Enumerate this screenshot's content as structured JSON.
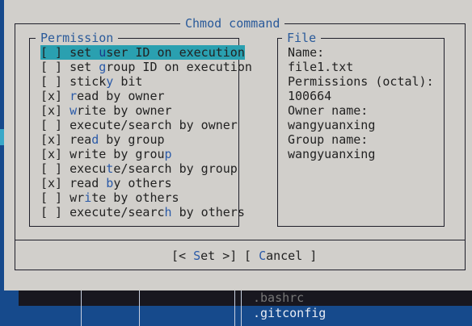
{
  "dialog": {
    "title": "Chmod command",
    "permission_legend": "Permission",
    "file_legend": "File",
    "permissions": [
      {
        "label": "set user ID on execution",
        "checked": false,
        "hotkey": 4,
        "selected": true
      },
      {
        "label": "set group ID on execution",
        "checked": false,
        "hotkey": 4
      },
      {
        "label": "sticky bit",
        "checked": false,
        "hotkey": 5
      },
      {
        "label": "read by owner",
        "checked": true,
        "hotkey": 0
      },
      {
        "label": "write by owner",
        "checked": true,
        "hotkey": 0
      },
      {
        "label": "execute/search by owner",
        "checked": false,
        "hotkey": -1
      },
      {
        "label": "read by group",
        "checked": true,
        "hotkey": 3
      },
      {
        "label": "write by group",
        "checked": true,
        "hotkey": 13
      },
      {
        "label": "execute/search by group",
        "checked": false,
        "hotkey": 5
      },
      {
        "label": "read by others",
        "checked": true,
        "hotkey": 5
      },
      {
        "label": "write by others",
        "checked": false,
        "hotkey": 2
      },
      {
        "label": "execute/search by others",
        "checked": false,
        "hotkey": 13
      }
    ],
    "file": {
      "name_label": "Name:",
      "name": "file1.txt",
      "perm_label": "Permissions (octal):",
      "perm": "100664",
      "owner_label": "Owner name:",
      "owner": "wangyuanxing",
      "group_label": "Group name:",
      "group": "wangyuanxing"
    },
    "buttons": {
      "set": {
        "pre": "[< ",
        "hot": "S",
        "post": "et >]"
      },
      "cancel": {
        "pre": "[ ",
        "hot": "C",
        "post": "ancel ]"
      }
    }
  },
  "background_panel": {
    "files": [
      ".bashrc",
      ".gitconfig"
    ]
  }
}
